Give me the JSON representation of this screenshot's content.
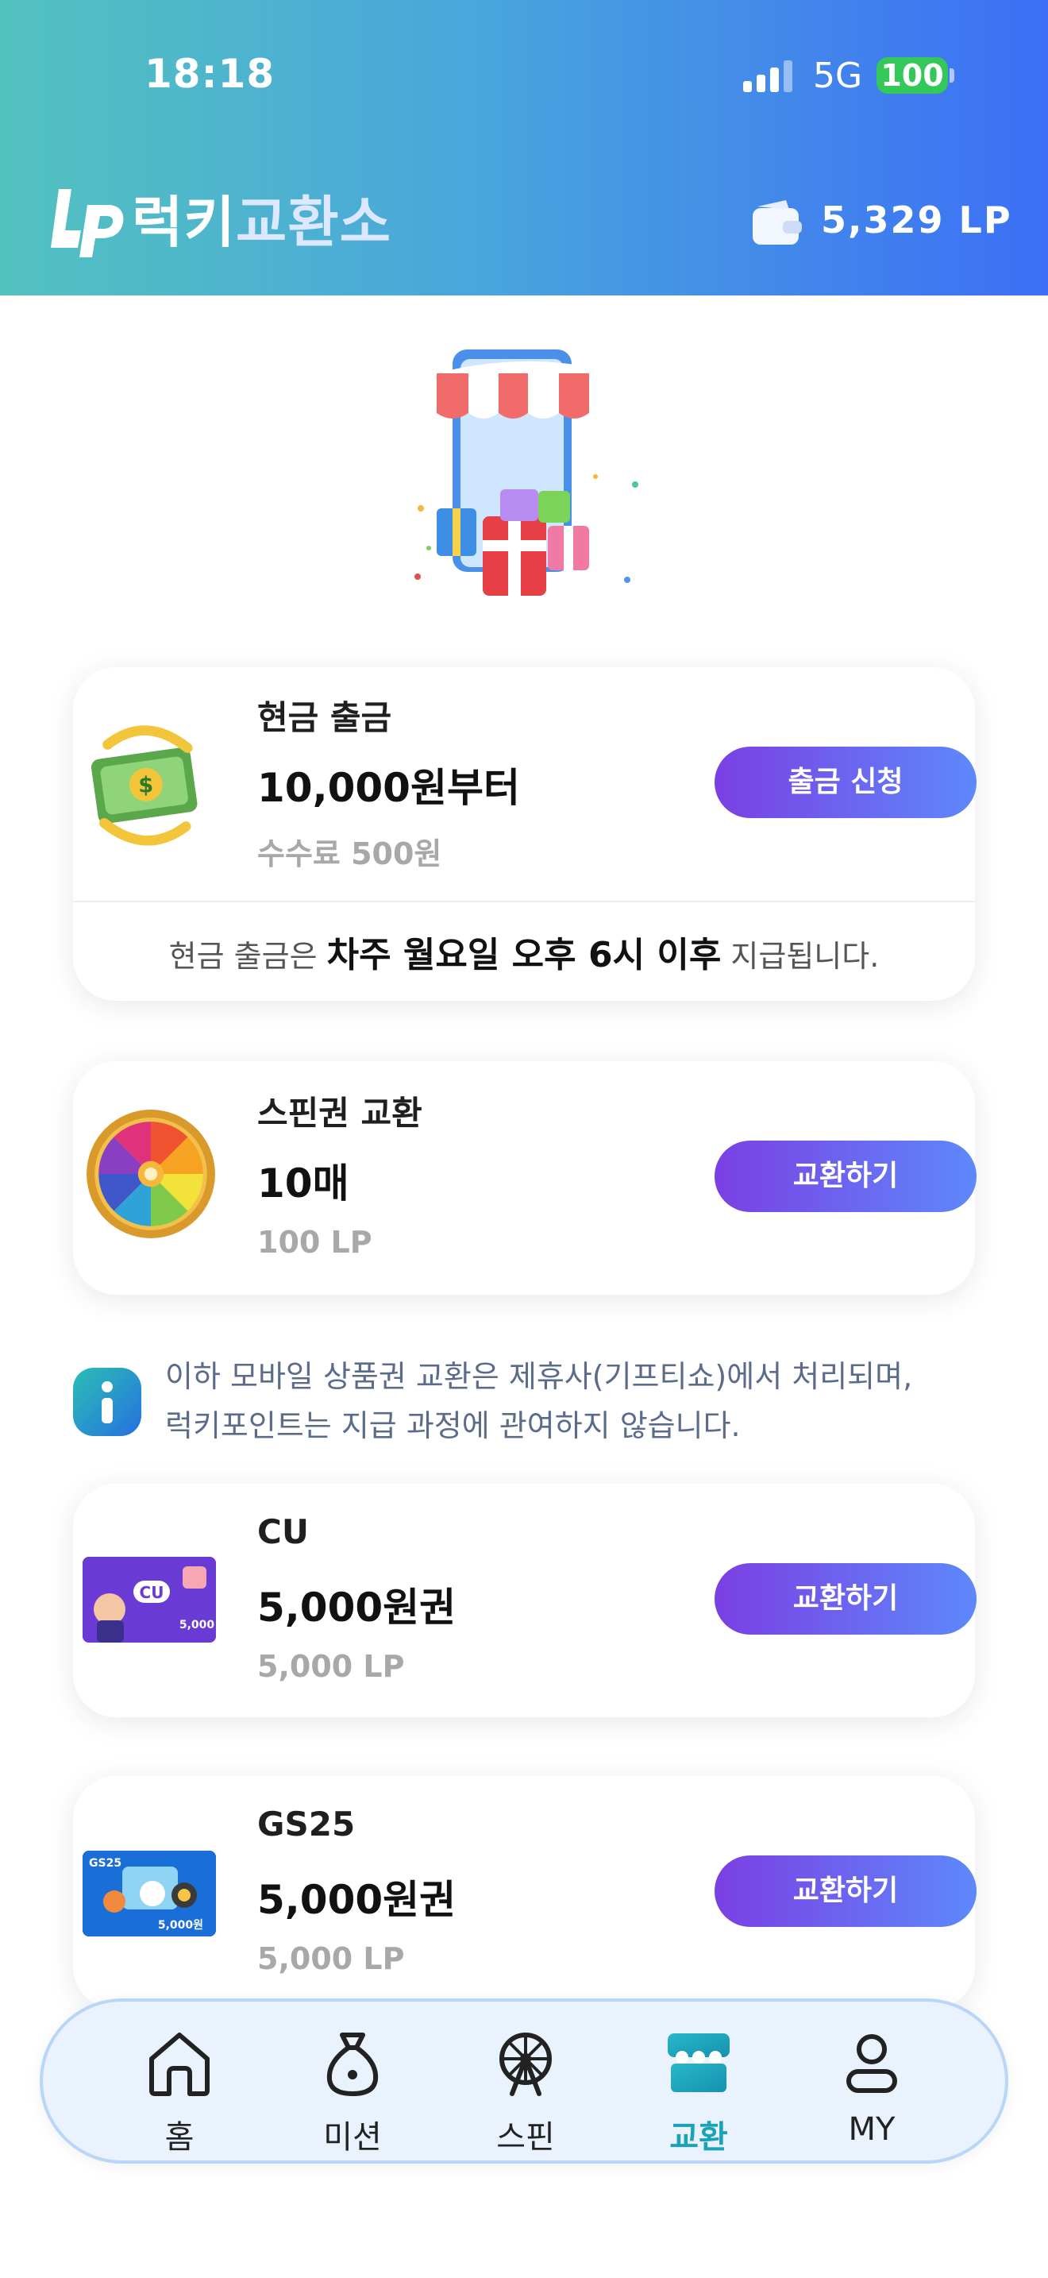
{
  "status_bar": {
    "time": "18:18",
    "network": "5G",
    "battery": "100"
  },
  "header": {
    "brand_part1": "럭키",
    "brand_part2": "교환소",
    "balance": "5,329 LP"
  },
  "cash_card": {
    "title": "현금 출금",
    "value": "10,000원부터",
    "sub": "수수료 500원",
    "button": "출금 신청",
    "notice_pre": "현금 출금은 ",
    "notice_bold": "차주 월요일 오후 6시 이후",
    "notice_post": " 지급됩니다."
  },
  "spin_card": {
    "title": "스핀권 교환",
    "value": "10매",
    "sub": "100 LP",
    "button": "교환하기"
  },
  "info": {
    "line1": "이하 모바일 상품권 교환은 제휴사(기프티쇼)에서 처리되며,",
    "line2": "럭키포인트는 지급 과정에 관여하지 않습니다."
  },
  "products": [
    {
      "title": "CU",
      "value": "5,000원권",
      "sub": "5,000 LP",
      "button": "교환하기",
      "card_label": "CU",
      "card_amount": "5,000"
    },
    {
      "title": "GS25",
      "value": "5,000원권",
      "sub": "5,000 LP",
      "button": "교환하기",
      "card_label": "GS25",
      "card_amount": "5,000원"
    }
  ],
  "tabs": [
    {
      "label": "홈",
      "icon": "home-icon"
    },
    {
      "label": "미션",
      "icon": "money-bag-icon"
    },
    {
      "label": "스핀",
      "icon": "ferris-wheel-icon"
    },
    {
      "label": "교환",
      "icon": "store-icon",
      "active": true
    },
    {
      "label": "MY",
      "icon": "user-icon"
    }
  ],
  "colors": {
    "accent": "#1aa3b8",
    "button_start": "#7b3fe4",
    "button_end": "#5d89fb"
  }
}
